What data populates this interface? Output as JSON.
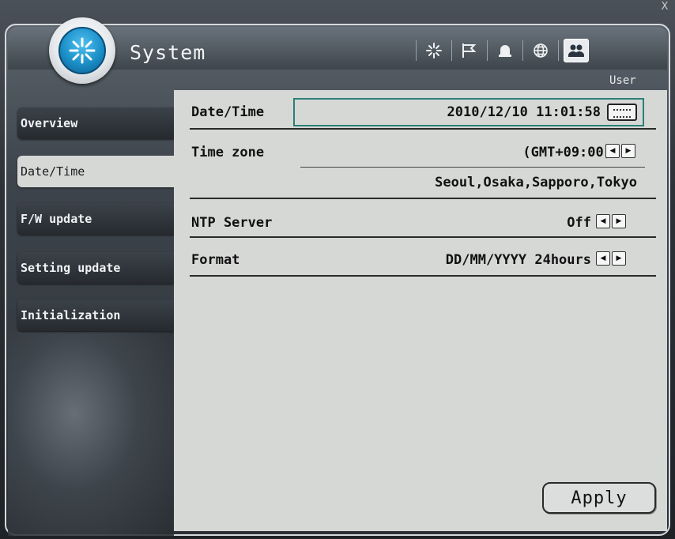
{
  "window": {
    "close_glyph": "X"
  },
  "header": {
    "title": "System",
    "toolbar_icons": [
      "spark-icon",
      "flag-icon",
      "alarm-icon",
      "globe-icon",
      "users-icon"
    ],
    "active_section": "User"
  },
  "sidebar": {
    "items": [
      {
        "label": "Overview"
      },
      {
        "label": "Date/Time"
      },
      {
        "label": "F/W update"
      },
      {
        "label": "Setting update"
      },
      {
        "label": "Initialization"
      }
    ],
    "active": "Date/Time"
  },
  "settings": {
    "datetime": {
      "label": "Date/Time",
      "value": "2010/12/10 11:01:58"
    },
    "timezone": {
      "label": "Time zone",
      "value": "(GMT+09:00)",
      "cities": "Seoul,Osaka,Sapporo,Tokyo"
    },
    "ntp": {
      "label": "NTP Server",
      "value": "Off"
    },
    "format": {
      "label": "Format",
      "value": "DD/MM/YYYY 24hours"
    }
  },
  "actions": {
    "apply_label": "Apply"
  },
  "colors": {
    "accent_border": "#2c7f78",
    "logo_blue": "#1b8fc8",
    "panel_bg": "#d6d8d6"
  }
}
